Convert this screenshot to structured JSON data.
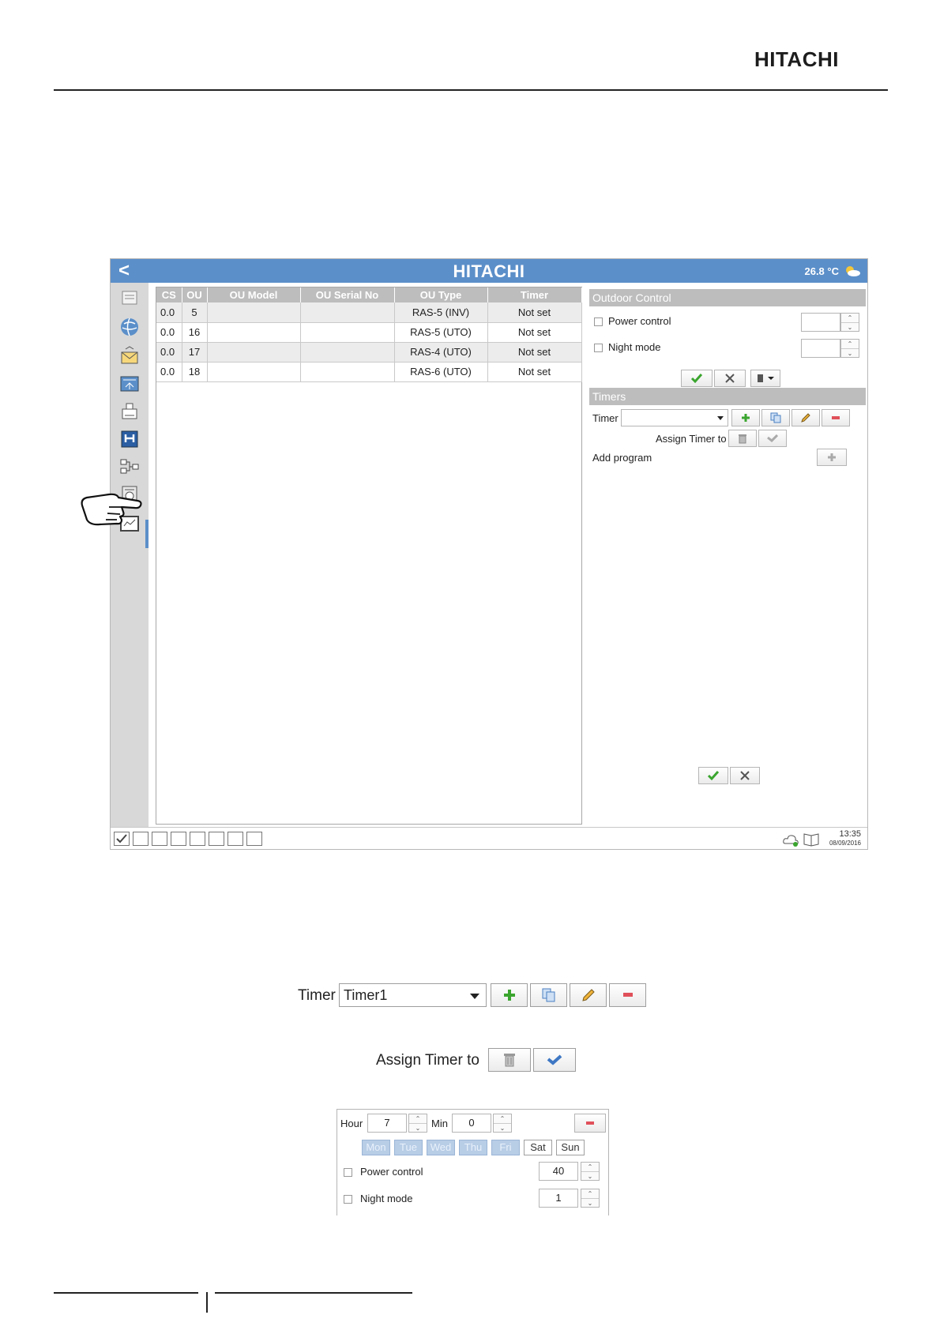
{
  "page": {
    "brand": "HITACHI"
  },
  "app": {
    "title": "HITACHI",
    "temperature": "26.8 °C",
    "table": {
      "headers": [
        "CS",
        "OU",
        "OU Model",
        "OU Serial No",
        "OU Type",
        "Timer"
      ],
      "rows": [
        [
          "0.0",
          "5",
          "",
          "",
          "RAS-5 (INV)",
          "Not set"
        ],
        [
          "0.0",
          "16",
          "",
          "",
          "RAS-5 (UTO)",
          "Not set"
        ],
        [
          "0.0",
          "17",
          "",
          "",
          "RAS-4 (UTO)",
          "Not set"
        ],
        [
          "0.0",
          "18",
          "",
          "",
          "RAS-6 (UTO)",
          "Not set"
        ]
      ]
    },
    "outdoor_control": {
      "title": "Outdoor Control",
      "power_control": "Power control",
      "night_mode": "Night mode"
    },
    "timers": {
      "title": "Timers",
      "timer_label": "Timer",
      "assign_label": "Assign Timer to",
      "add_program": "Add program"
    },
    "status": {
      "time": "13:35",
      "date": "08/09/2016"
    }
  },
  "detail": {
    "timer_label": "Timer",
    "timer_value": "Timer1",
    "assign_label": "Assign Timer to",
    "program": {
      "hour_label": "Hour",
      "hour_value": "7",
      "min_label": "Min",
      "min_value": "0",
      "days": [
        {
          "label": "Mon",
          "on": false
        },
        {
          "label": "Tue",
          "on": false
        },
        {
          "label": "Wed",
          "on": false
        },
        {
          "label": "Thu",
          "on": false
        },
        {
          "label": "Fri",
          "on": false
        },
        {
          "label": "Sat",
          "on": true
        },
        {
          "label": "Sun",
          "on": true
        }
      ],
      "power_control": "Power control",
      "power_value": "40",
      "night_mode": "Night mode",
      "night_value": "1"
    }
  },
  "colors": {
    "header_blue": "#5b8fc9",
    "section_grey": "#bdbdbd",
    "check_green": "#3aa52e",
    "delete_red": "#e0505a"
  }
}
